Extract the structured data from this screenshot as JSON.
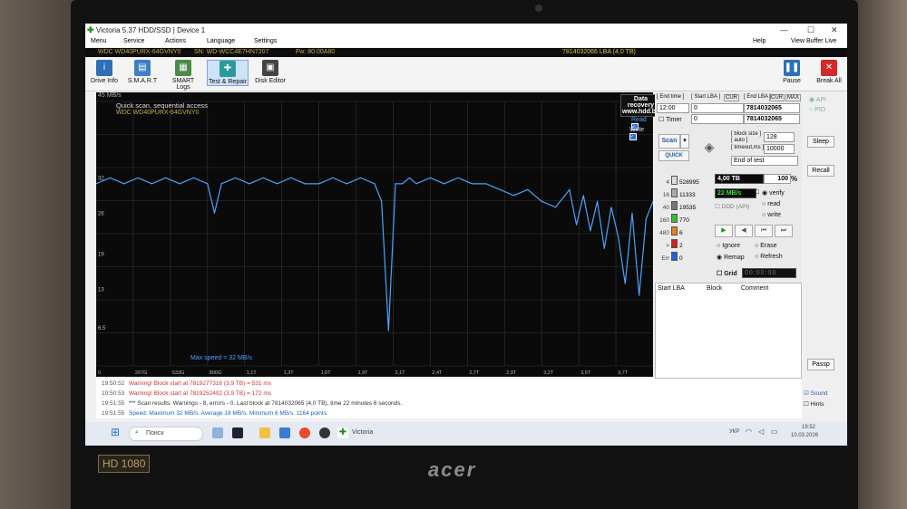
{
  "window": {
    "title": "Victoria 5.37 HDD/SSD | Device 1",
    "menu": [
      "Menu",
      "Service",
      "Actions",
      "Language",
      "Settings"
    ],
    "help": "Help",
    "view_buffer": "View Buffer Live"
  },
  "infobar": {
    "model": "WDC WD40PURX-64GVNY0",
    "serial": "SN: WD-WCC4E7HN7207",
    "fw": "Fw: 80.00A80",
    "lba": "7814032066 LBA (4,0 TB)"
  },
  "toolbar": {
    "buttons": [
      "Drive Info",
      "S.M.A.R.T",
      "SMART Logs",
      "Test & Repair",
      "Disk Editor"
    ],
    "pause": "Pause",
    "break_all": "Break All"
  },
  "graph": {
    "y_unit": "45 MB/s",
    "title": "Quick scan, sequential access",
    "model": "WDC WD40PURX-64GVNY0",
    "read_label": "Read",
    "write_label": "Write",
    "max_speed": "Max speed = 32 MB/s",
    "data_recovery_1": "Data recovery",
    "data_recovery_2": "www.hdd.by",
    "y_ticks": [
      "32",
      "26",
      "19",
      "13",
      "6.5"
    ],
    "x_ticks": [
      "0",
      "267G",
      "533G",
      "800G",
      "1,1T",
      "1,3T",
      "1,6T",
      "1,9T",
      "2,1T",
      "2,4T",
      "2,7T",
      "2,9T",
      "3,2T",
      "3,5T",
      "3,7T",
      "4,0T"
    ]
  },
  "chart_data": {
    "type": "line",
    "title": "Quick scan, sequential access",
    "ylabel": "MB/s",
    "ylim": [
      0,
      45
    ],
    "xlim": [
      0,
      4.0
    ],
    "series": [
      {
        "name": "Read",
        "x": [
          0,
          0.1,
          0.2,
          0.3,
          0.4,
          0.5,
          0.6,
          0.7,
          0.8,
          0.85,
          0.9,
          1.0,
          1.1,
          1.2,
          1.3,
          1.4,
          1.5,
          1.6,
          1.7,
          1.8,
          1.9,
          2.0,
          2.05,
          2.1,
          2.15,
          2.2,
          2.25,
          2.3,
          2.4,
          2.5,
          2.6,
          2.7,
          2.8,
          2.9,
          3.0,
          3.1,
          3.2,
          3.3,
          3.4,
          3.45,
          3.5,
          3.55,
          3.6,
          3.65,
          3.7,
          3.75,
          3.8,
          3.85,
          3.9,
          3.95,
          4.0
        ],
        "y": [
          31,
          32,
          31,
          32,
          31,
          32,
          31,
          32,
          31,
          26,
          31,
          32,
          31,
          32,
          31,
          32,
          31,
          31,
          32,
          31,
          32,
          31,
          28,
          6,
          31,
          31,
          32,
          31,
          32,
          31,
          32,
          31,
          31,
          30,
          29,
          30,
          28,
          27,
          30,
          24,
          29,
          23,
          28,
          20,
          27,
          22,
          14,
          26,
          12,
          25,
          28
        ]
      }
    ]
  },
  "panel": {
    "end_time_lbl": "[ End time ]",
    "start_lba_lbl": "[ Start LBA ]",
    "end_lba_lbl": "[ End LBA ]",
    "cur": "CUR",
    "max": "MAX",
    "time": "12:00",
    "start_lba": "0",
    "end_lba": "7814032065",
    "timer_lbl": "Timer",
    "timer": "0",
    "end_lba_cur": "7814032065",
    "scan": "Scan",
    "quick": "QUICK",
    "block_size_lbl": "[ block size ]",
    "auto_lbl": "[ auto ]",
    "timeout_lbl": "[ timeout,ms ]",
    "block_size": "128",
    "timeout": "10000",
    "end_of_test": "End of test",
    "api": "API",
    "pio": "PIO",
    "sleep": "Sleep",
    "recall": "Recall",
    "passp": "Passp",
    "counts": [
      {
        "ms": "4",
        "n": "528995",
        "color": "#dddddd"
      },
      {
        "ms": "16",
        "n": "11333",
        "color": "#aaaaaa"
      },
      {
        "ms": "40",
        "n": "19535",
        "color": "#777777"
      },
      {
        "ms": "160",
        "n": "770",
        "color": "#2fbf2f"
      },
      {
        "ms": "480",
        "n": "6",
        "color": "#e88020"
      },
      {
        "ms": ">",
        "n": "2",
        "color": "#d02020"
      },
      {
        "ms": "Err",
        "n": "0",
        "color": "#2060e0"
      }
    ],
    "size": "4,00 TB",
    "percent": "100",
    "pct_sign": "%",
    "speed": "22 MB/s",
    "ddd": "DDD (API)",
    "verify": "verify",
    "read": "read",
    "write": "write",
    "ignore": "Ignore",
    "erase": "Erase",
    "remap": "Remap",
    "refresh": "Refresh",
    "grid": "Grid",
    "clock": "00:00:00",
    "col_start": "Start LBA",
    "col_block": "Block",
    "col_comment": "Comment",
    "sound": "Sound",
    "hints": "Hints"
  },
  "log": [
    {
      "t": "19:50:52",
      "m": "Warning! Block start at 7819277316 (3,9 TB) = 531 ms",
      "c": "#d03030"
    },
    {
      "t": "19:50:53",
      "m": "Warning! Block start at 7819252492 (3,9 TB) = 172 ms",
      "c": "#d03030"
    },
    {
      "t": "19:51:55",
      "m": "*** Scan results: Warnings - 8, errors - 0. Last block at 7814032065 (4,0 TB), time 22 minutes 6 seconds.",
      "c": "#303030"
    },
    {
      "t": "19:51:55",
      "m": "Speed: Maximum 32 MB/s. Average 18 MB/s. Minimum 6 MB/s. 1164 points.",
      "c": "#2060c0"
    }
  ],
  "taskbar": {
    "search": "Поиск",
    "app": "Victoria",
    "lang": "УКР",
    "time": "19:52",
    "date": "10.03.2026"
  },
  "laptop": {
    "brand": "acer",
    "badge": "HD 1080"
  }
}
